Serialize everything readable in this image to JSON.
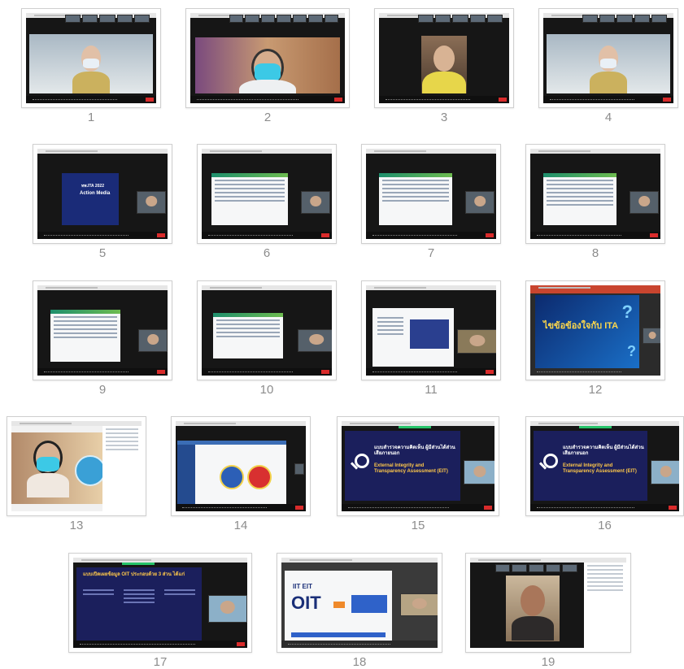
{
  "tiles": [
    {
      "num": "1"
    },
    {
      "num": "2"
    },
    {
      "num": "3"
    },
    {
      "num": "4"
    },
    {
      "num": "5"
    },
    {
      "num": "6"
    },
    {
      "num": "7"
    },
    {
      "num": "8"
    },
    {
      "num": "9"
    },
    {
      "num": "10"
    },
    {
      "num": "11"
    },
    {
      "num": "12"
    },
    {
      "num": "13"
    },
    {
      "num": "14"
    },
    {
      "num": "15"
    },
    {
      "num": "16"
    },
    {
      "num": "17"
    },
    {
      "num": "18"
    },
    {
      "num": "19"
    }
  ],
  "slides": {
    "s5": {
      "line1": "ทพ.ITA 2022",
      "line2": "Action Media"
    },
    "s12": {
      "title": "ไขข้อข้องใจกับ ITA"
    },
    "s15": {
      "th": "แบบสำรวจความคิดเห็น ผู้มีส่วนได้ส่วนเสียภายนอก",
      "en": "External Integrity and Transparency Assessment (EIT)"
    },
    "s16": {
      "th": "แบบสำรวจความคิดเห็น ผู้มีส่วนได้ส่วนเสียภายนอก",
      "en": "External Integrity and Transparency Assessment (EIT)"
    },
    "s17": {
      "title": "แบบเปิดเผยข้อมูล OIT ประกอบด้วย 3 ส่วน ได้แก่"
    },
    "s18": {
      "big": "OIT",
      "top": "IIT EIT"
    }
  },
  "colors": {
    "end_button": "#d92b2b",
    "zoom_bg": "#161616",
    "slide_navy": "#1b1f5c"
  }
}
